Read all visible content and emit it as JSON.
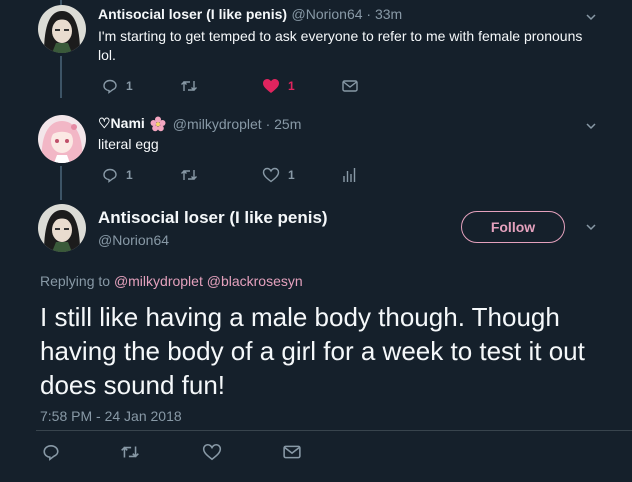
{
  "tweet1": {
    "name": "Antisocial loser (I like penis)",
    "handle": "@Norion64 · 33m",
    "text": "I'm starting to get temped to ask everyone to refer to me with female pronouns lol.",
    "reply_count": "1",
    "like_count": "1"
  },
  "tweet2": {
    "name": "♡Nami",
    "handle": "@milkydroplet · 25m",
    "text": "literal egg",
    "reply_count": "1",
    "like_count": "1"
  },
  "main_tweet": {
    "name": "Antisocial loser (I like penis)",
    "handle": "@Norion64",
    "follow_label": "Follow",
    "replying_prefix": "Replying to",
    "replying_to_1": "@milkydroplet",
    "replying_to_2": "@blackrosesyn",
    "text": "I still like having a male body though. Though having the body of a girl for a week to test it out does sound fun!",
    "timestamp": "7:58 PM - 24 Jan 2018"
  },
  "colors": {
    "background": "#15202b",
    "accent_pink": "#e4a1bd",
    "like_red": "#e0245e",
    "muted": "#8899a6"
  }
}
